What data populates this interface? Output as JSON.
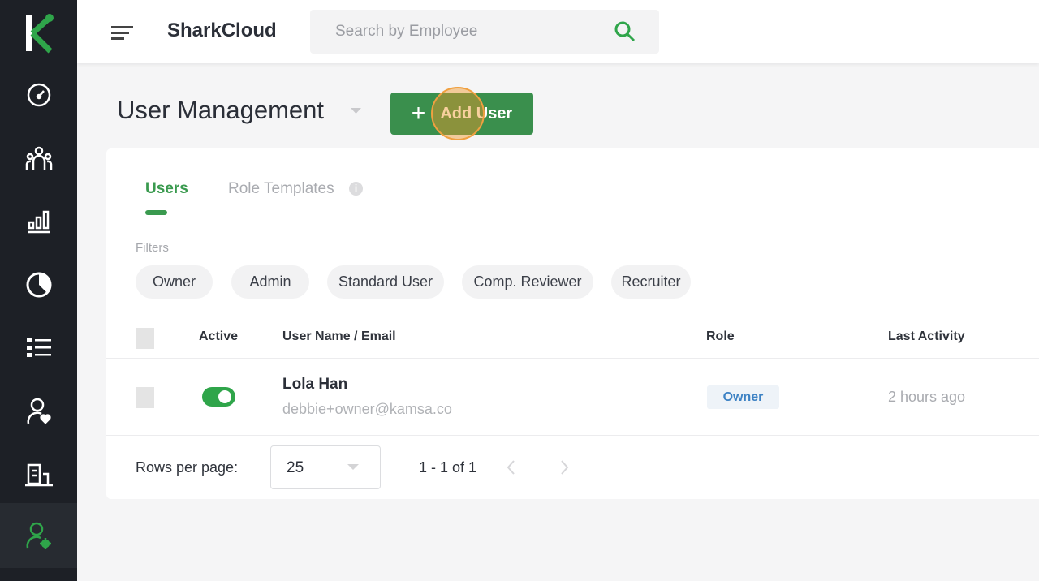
{
  "app": {
    "title": "SharkCloud",
    "search_placeholder": "Search by Employee",
    "logo": "K"
  },
  "sidebar": {
    "items": [
      {
        "icon": "dashboard-icon"
      },
      {
        "icon": "people-icon"
      },
      {
        "icon": "bar-chart-icon"
      },
      {
        "icon": "pie-chart-icon"
      },
      {
        "icon": "list-icon"
      },
      {
        "icon": "user-heart-icon"
      },
      {
        "icon": "building-icon"
      },
      {
        "icon": "user-settings-icon",
        "selected": true
      }
    ]
  },
  "page": {
    "title": "User Management",
    "add_button": "Add User",
    "add_icon": "+"
  },
  "tabs": [
    {
      "label": "Users",
      "active": true
    },
    {
      "label": "Role Templates"
    }
  ],
  "filters": {
    "label": "Filters",
    "chips": [
      "Owner",
      "Admin",
      "Standard User",
      "Comp. Reviewer",
      "Recruiter"
    ]
  },
  "table": {
    "headers": {
      "active": "Active",
      "name": "User Name / Email",
      "role": "Role",
      "last": "Last Activity"
    },
    "rows": [
      {
        "name": "Lola Han",
        "email": "debbie+owner@kamsa.co",
        "role": "Owner",
        "last": "2 hours ago",
        "active": true
      }
    ]
  },
  "pagination": {
    "rows_label": "Rows per page:",
    "rows_value": "25",
    "range": "1 - 1 of 1"
  },
  "colors": {
    "accent": "#3a9a4f",
    "sidebar": "#1d2026"
  }
}
